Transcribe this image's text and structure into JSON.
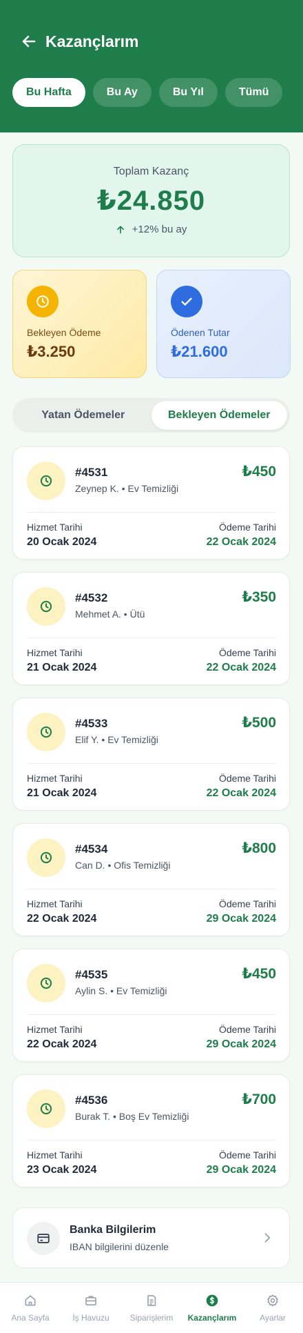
{
  "header": {
    "title": "Kazançlarım",
    "back_icon": "arrow-left-icon",
    "period_tabs": [
      {
        "label": "Bu Hafta",
        "active": true
      },
      {
        "label": "Bu Ay",
        "active": false
      },
      {
        "label": "Bu Yıl",
        "active": false
      },
      {
        "label": "Tümü",
        "active": false
      }
    ]
  },
  "total": {
    "label": "Toplam Kazanç",
    "value": "₺24.850",
    "change": "+12% bu ay"
  },
  "stats": {
    "pending": {
      "label": "Bekleyen Ödeme",
      "value": "₺3.250",
      "icon": "clock-icon"
    },
    "paid": {
      "label": "Ödenen Tutar",
      "value": "₺21.600",
      "icon": "check-icon"
    }
  },
  "segments": {
    "deposited": "Yatan Ödemeler",
    "pending": "Bekleyen Ödemeler",
    "active": "pending"
  },
  "labels": {
    "service_date": "Hizmet Tarihi",
    "payment_date": "Ödeme Tarihi"
  },
  "orders": [
    {
      "id": "#4531",
      "customer": "Zeynep K. • Ev Temizliği",
      "amount": "₺450",
      "service_date": "20 Ocak 2024",
      "payment_date": "22 Ocak 2024"
    },
    {
      "id": "#4532",
      "customer": "Mehmet A. • Ütü",
      "amount": "₺350",
      "service_date": "21 Ocak 2024",
      "payment_date": "22 Ocak 2024"
    },
    {
      "id": "#4533",
      "customer": "Elif Y. • Ev Temizliği",
      "amount": "₺500",
      "service_date": "21 Ocak 2024",
      "payment_date": "22 Ocak 2024"
    },
    {
      "id": "#4534",
      "customer": "Can D. • Ofis Temizliği",
      "amount": "₺800",
      "service_date": "22 Ocak 2024",
      "payment_date": "29 Ocak 2024"
    },
    {
      "id": "#4535",
      "customer": "Aylin S. • Ev Temizliği",
      "amount": "₺450",
      "service_date": "22 Ocak 2024",
      "payment_date": "29 Ocak 2024"
    },
    {
      "id": "#4536",
      "customer": "Burak T. • Boş Ev Temizliği",
      "amount": "₺700",
      "service_date": "23 Ocak 2024",
      "payment_date": "29 Ocak 2024"
    }
  ],
  "bank": {
    "title": "Banka Bilgilerim",
    "subtitle": "IBAN bilgilerini düzenle"
  },
  "nav": [
    {
      "label": "Ana Sayfa",
      "icon": "home-icon"
    },
    {
      "label": "İş Havuzu",
      "icon": "briefcase-icon"
    },
    {
      "label": "Siparişlerim",
      "icon": "document-icon"
    },
    {
      "label": "Kazançlarım",
      "icon": "dollar-coin-icon",
      "active": true
    },
    {
      "label": "Ayarlar",
      "icon": "gear-icon"
    }
  ],
  "colors": {
    "primary": "#1e7d4a",
    "pending_accent": "#f5b400",
    "paid_accent": "#2f6ce0"
  }
}
